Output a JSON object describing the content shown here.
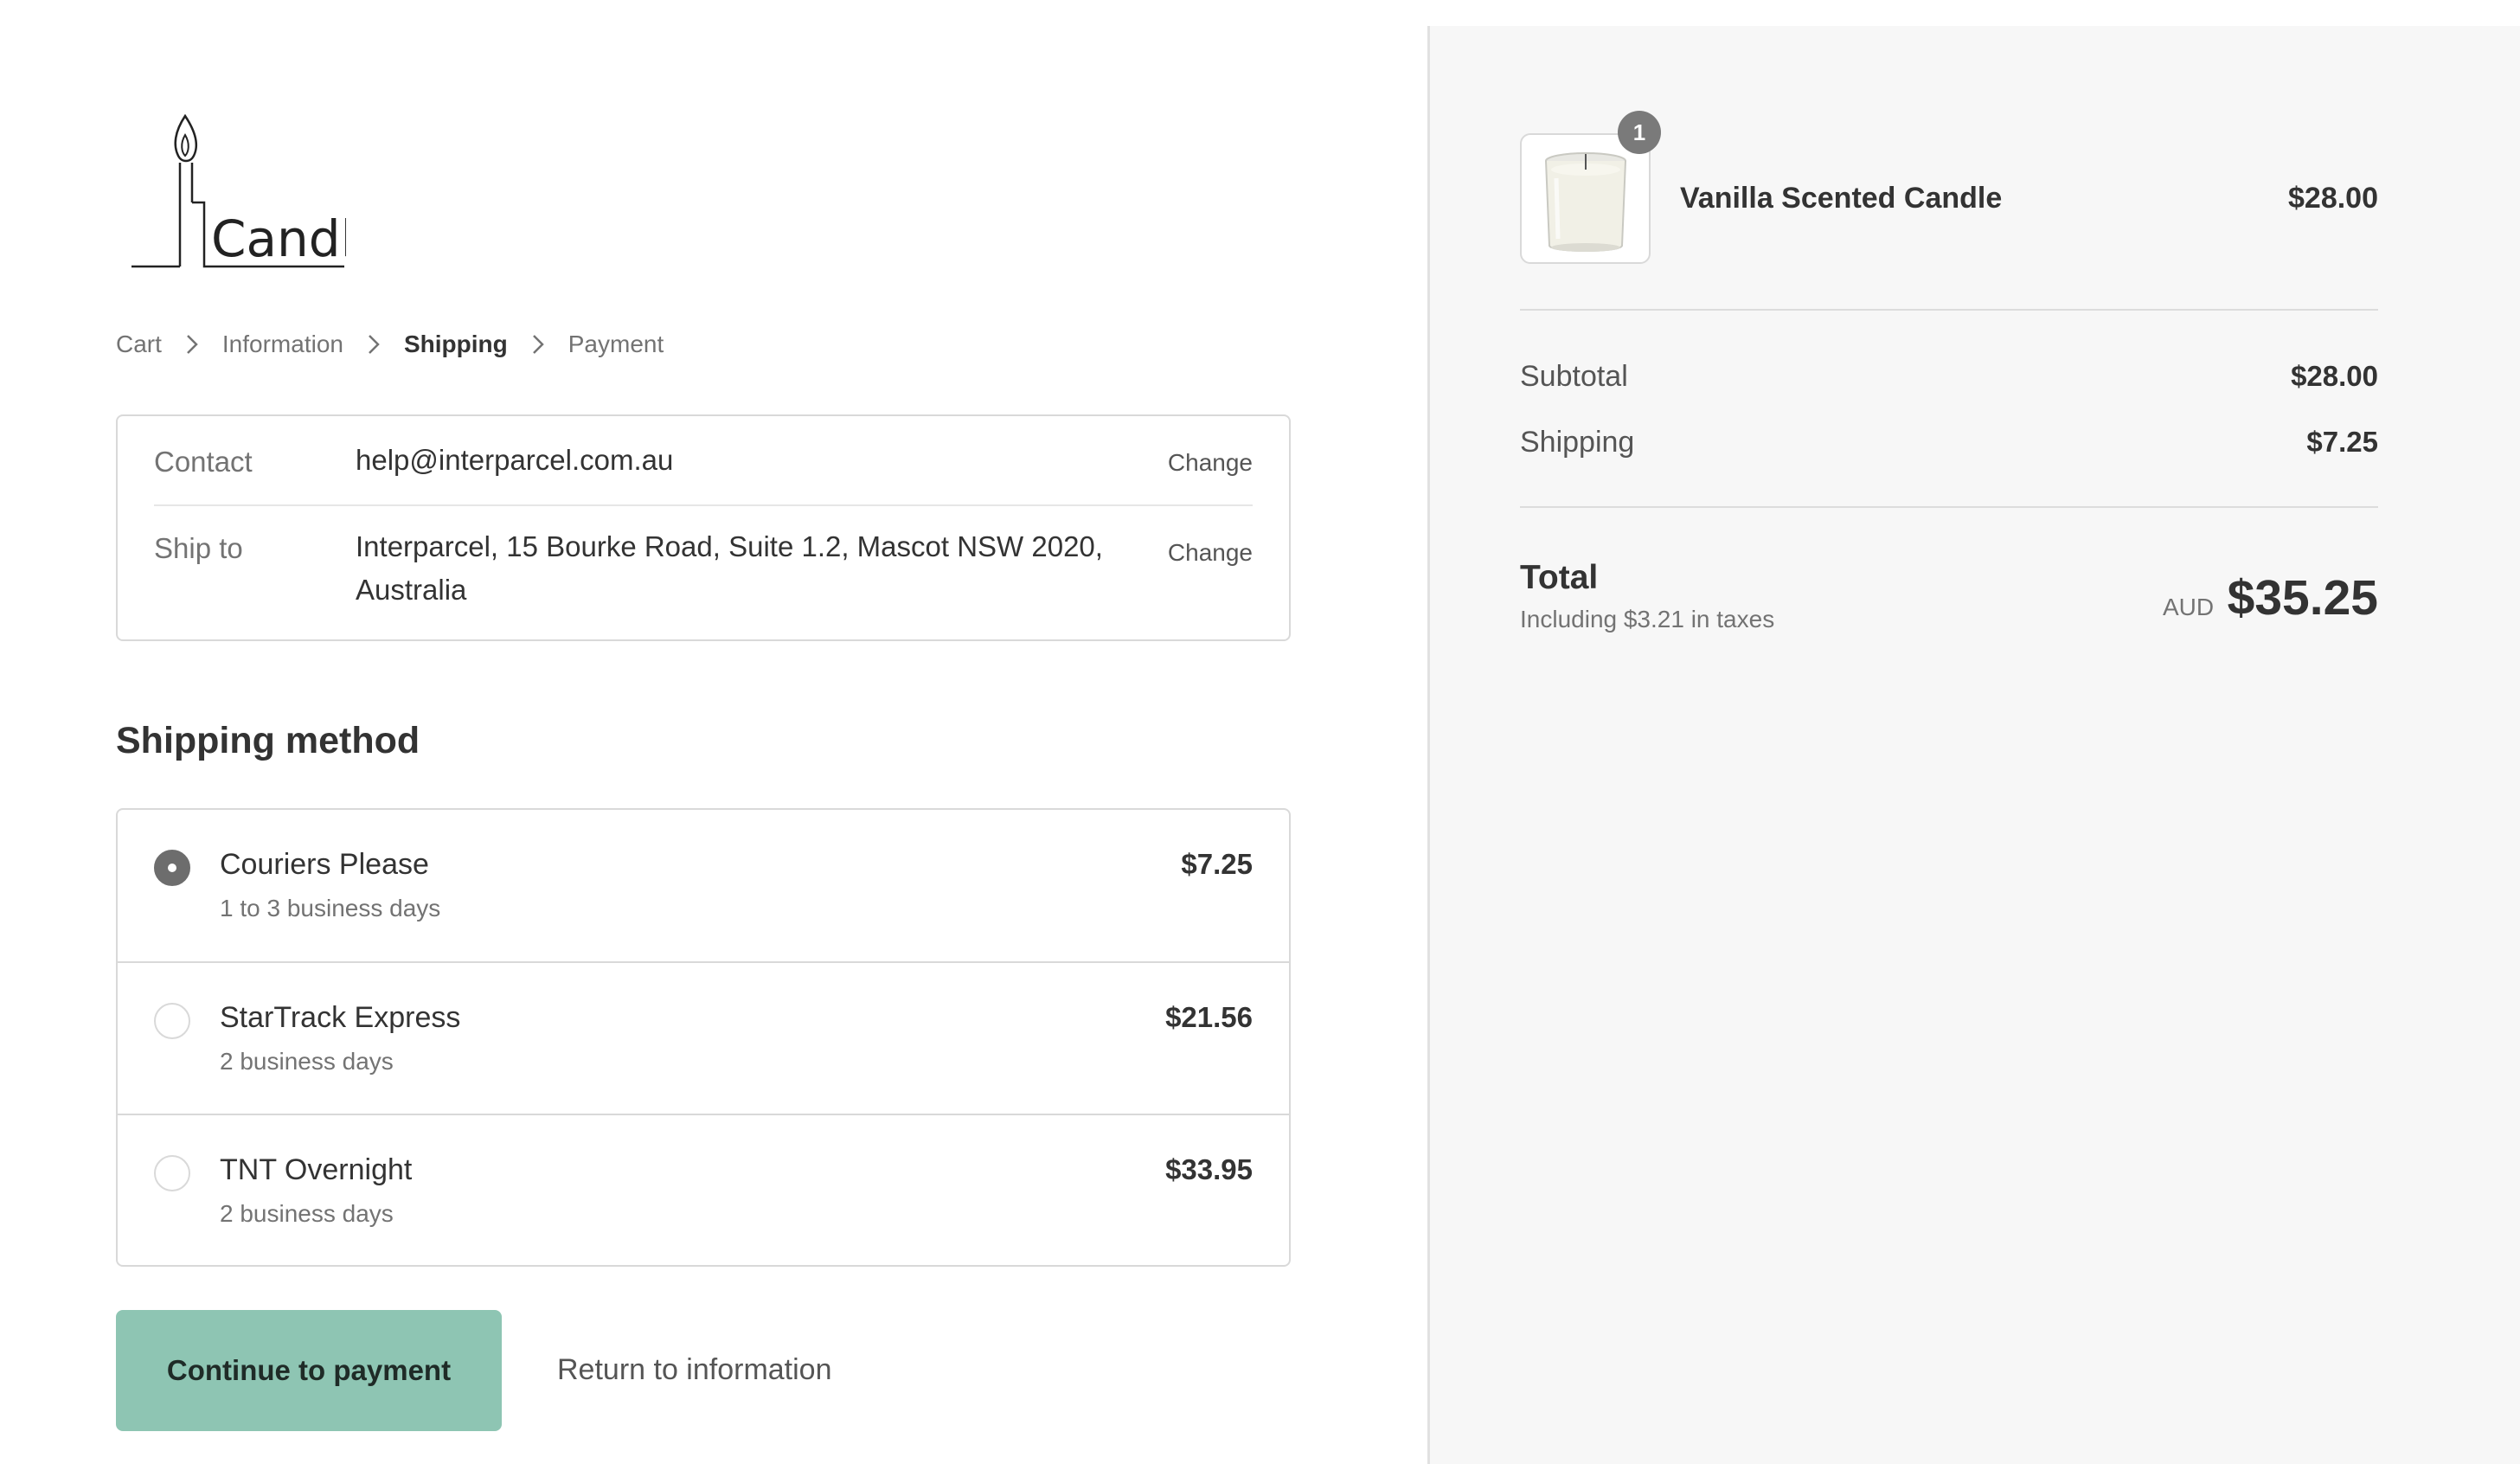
{
  "store": {
    "logo_text": "Candles"
  },
  "breadcrumb": {
    "items": [
      {
        "label": "Cart"
      },
      {
        "label": "Information"
      },
      {
        "label": "Shipping"
      },
      {
        "label": "Payment"
      }
    ],
    "current": "Shipping"
  },
  "review": {
    "contact_label": "Contact",
    "contact_value": "help@interparcel.com.au",
    "contact_change": "Change",
    "ship_to_label": "Ship to",
    "ship_to_value": "Interparcel, 15 Bourke Road, Suite 1.2, Mascot NSW 2020, Australia",
    "ship_to_change": "Change"
  },
  "shipping_method": {
    "title": "Shipping method",
    "options": [
      {
        "name": "Couriers Please",
        "eta": "1 to 3 business days",
        "price": "$7.25",
        "selected": true
      },
      {
        "name": "StarTrack Express",
        "eta": "2 business days",
        "price": "$21.56",
        "selected": false
      },
      {
        "name": "TNT Overnight",
        "eta": "2 business days",
        "price": "$33.95",
        "selected": false
      }
    ]
  },
  "actions": {
    "continue_label": "Continue to payment",
    "return_label": "Return to information"
  },
  "summary": {
    "item": {
      "quantity": "1",
      "name": "Vanilla Scented Candle",
      "price": "$28.00",
      "image_icon": "candle-jar-image"
    },
    "subtotal_label": "Subtotal",
    "subtotal_value": "$28.00",
    "shipping_label": "Shipping",
    "shipping_value": "$7.25",
    "total_label": "Total",
    "tax_note": "Including $3.21 in taxes",
    "currency": "AUD",
    "total_value": "$35.25"
  },
  "colors": {
    "primary_button": "#8ec5b3",
    "sidebar_bg": "#f7f7f7",
    "radio_selected": "#6d6d6d"
  }
}
